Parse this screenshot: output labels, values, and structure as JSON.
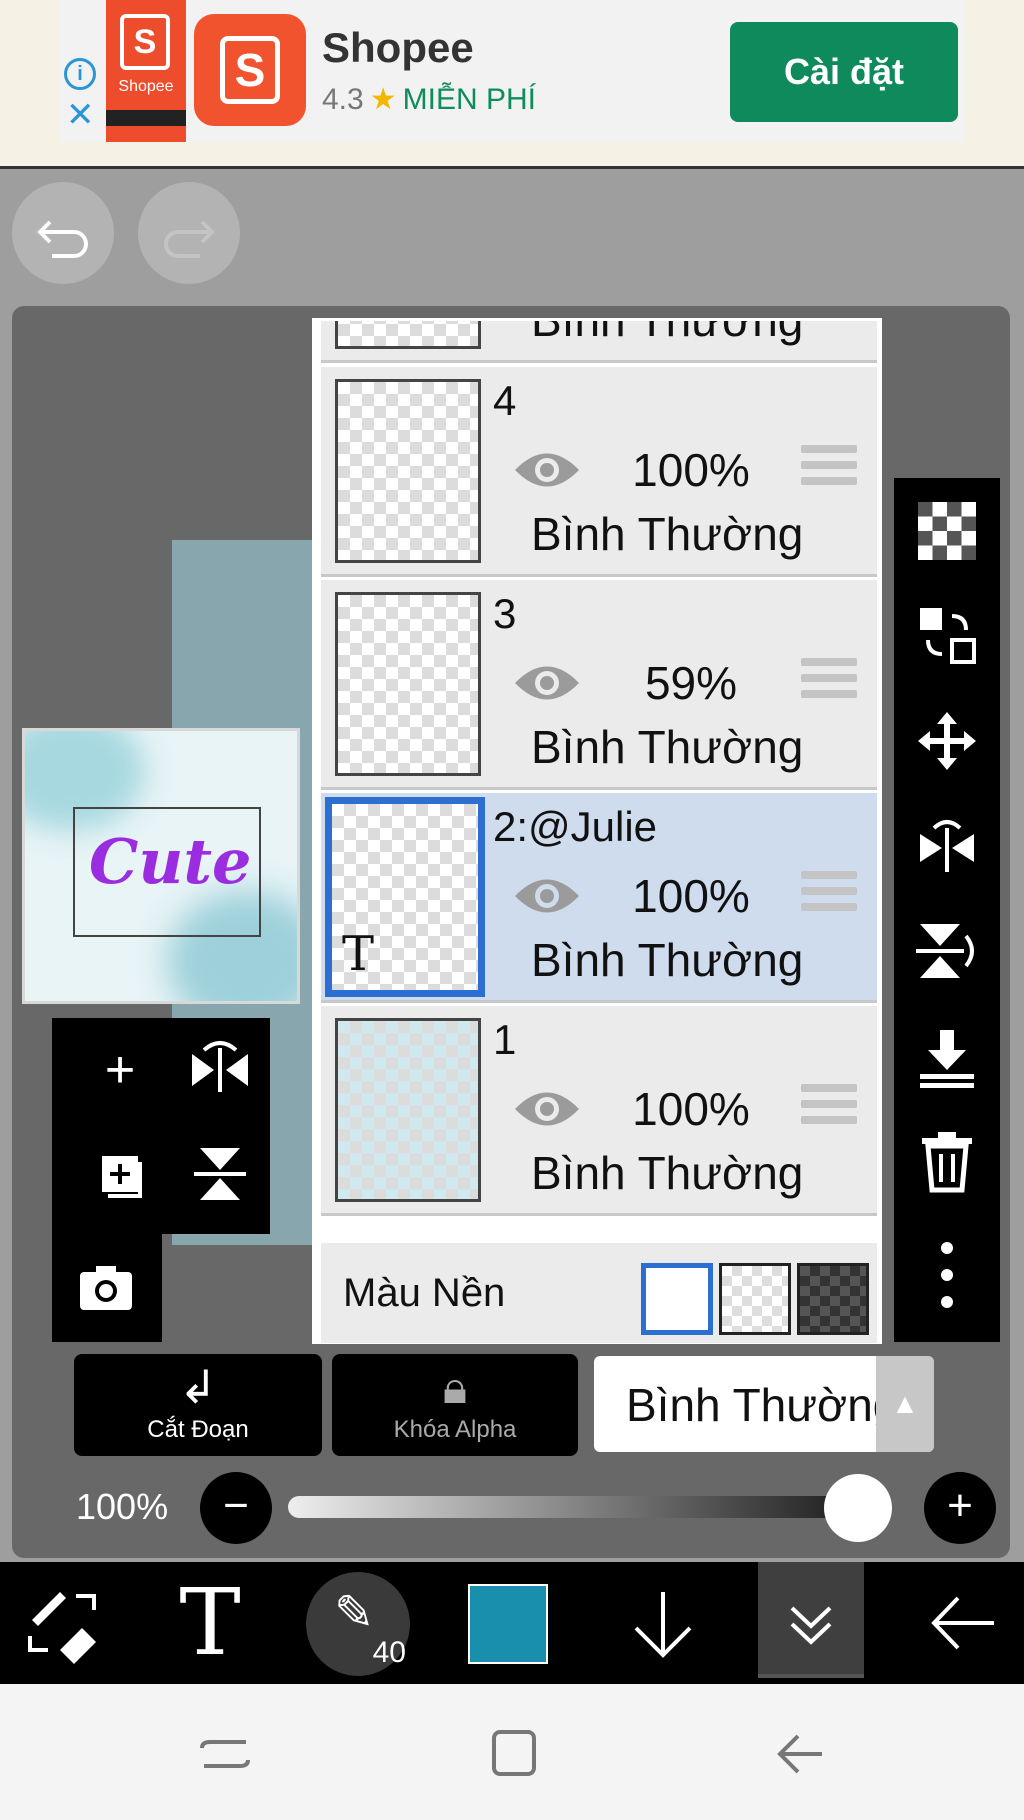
{
  "ad": {
    "info_icon": "info-icon",
    "close_icon": "close-icon",
    "screenshot_brand": "Shopee",
    "logo_letter": "S",
    "app_name": "Shopee",
    "rating": "4.3",
    "price": "MIỄN PHÍ",
    "cta": "Cài đặt",
    "colors": {
      "cta": "#0e8a5d",
      "brand": "#ee4d2d"
    }
  },
  "history": {
    "undo_icon": "undo-icon",
    "redo_icon": "redo-icon"
  },
  "thumbnail": {
    "text": "Cute"
  },
  "layers": {
    "items": [
      {
        "name": "",
        "opacity": "",
        "blend": "Bình Thường"
      },
      {
        "name": "4",
        "opacity": "100%",
        "blend": "Bình Thường"
      },
      {
        "name": "3",
        "opacity": "59%",
        "blend": "Bình Thường"
      },
      {
        "name": "2:@Julie",
        "opacity": "100%",
        "blend": "Bình Thường",
        "selected": true,
        "text_layer_glyph": "T"
      },
      {
        "name": "1",
        "opacity": "100%",
        "blend": "Bình Thường"
      }
    ],
    "background_label": "Màu Nền",
    "background_options": [
      "white",
      "transparent",
      "dark-checker"
    ],
    "selected_color": "#2d6fd1"
  },
  "controls": {
    "clip_label": "Cắt Đoạn",
    "alpha_label": "Khóa Alpha",
    "blend_mode": "Bình Thường",
    "opacity_label": "100%",
    "opacity_value": 1.0
  },
  "toolbar": {
    "brush_size": "40",
    "color": "#1a8fad",
    "text_tool_glyph": "T"
  }
}
